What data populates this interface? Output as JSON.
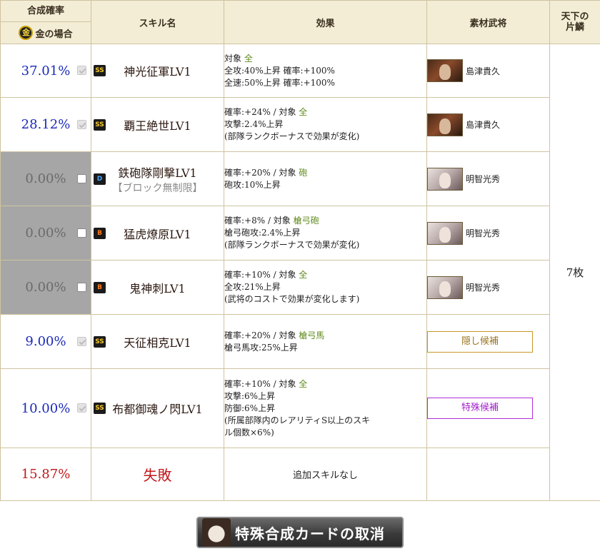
{
  "header": {
    "rate": "合成確率",
    "gold_case": "金の場合",
    "gold_icon_char": "金",
    "skill_name": "スキル名",
    "effect": "効果",
    "material": "素材武将",
    "tenka_line1": "天下の",
    "tenka_line2": "片鱗"
  },
  "rows": [
    {
      "rate": "37.01%",
      "checked": true,
      "rarity": "SS",
      "skill": "神光征軍LV1",
      "sub": "",
      "fx": [
        {
          "prefix": "対象",
          "target": "全",
          "text": ""
        },
        {
          "text": "全攻:40%上昇  確率:+100%"
        },
        {
          "text": "全速:50%上昇  確率:+100%"
        }
      ],
      "material": "島津貴久"
    },
    {
      "rate": "28.12%",
      "checked": true,
      "rarity": "SS",
      "skill": "覇王絶世LV1",
      "sub": "",
      "fx": [
        {
          "prefix": "確率:+24% / 対象",
          "target": "全",
          "text": ""
        },
        {
          "text": "攻撃:2.4%上昇"
        },
        {
          "text": "(部隊ランクボーナスで効果が変化)"
        }
      ],
      "material": "島津貴久"
    },
    {
      "rate": "0.00%",
      "checked": false,
      "rarity": "D",
      "skill": "鉄砲隊剛撃LV1",
      "sub": "【ブロック無制限】",
      "fx": [
        {
          "prefix": "確率:+20% / 対象",
          "target": "砲",
          "text": ""
        },
        {
          "text": "砲攻:10%上昇"
        }
      ],
      "material": "明智光秀"
    },
    {
      "rate": "0.00%",
      "checked": false,
      "rarity": "B",
      "skill": "猛虎燎原LV1",
      "sub": "",
      "fx": [
        {
          "prefix": "確率:+8% / 対象",
          "target": "槍弓砲",
          "text": ""
        },
        {
          "text": "槍弓砲攻:2.4%上昇"
        },
        {
          "text": "(部隊ランクボーナスで効果が変化)"
        }
      ],
      "material": "明智光秀"
    },
    {
      "rate": "0.00%",
      "checked": false,
      "rarity": "B",
      "skill": "鬼神刺LV1",
      "sub": "",
      "fx": [
        {
          "prefix": "確率:+10% / 対象",
          "target": "全",
          "text": ""
        },
        {
          "text": "全攻:21%上昇"
        },
        {
          "text": "(武将のコストで効果が変化します)"
        }
      ],
      "material": "明智光秀"
    },
    {
      "rate": "9.00%",
      "checked": true,
      "rarity": "SS",
      "skill": "天征相克LV1",
      "sub": "",
      "fx": [
        {
          "prefix": "確率:+20% / 対象",
          "target": "槍弓馬",
          "text": ""
        },
        {
          "text": "槍弓馬攻:25%上昇"
        }
      ],
      "candidate": "隠し候補"
    },
    {
      "rate": "10.00%",
      "checked": true,
      "rarity": "SS",
      "skill": "布都御魂ノ閃LV1",
      "sub": "",
      "fx": [
        {
          "prefix": "確率:+10% / 対象",
          "target": "全",
          "text": ""
        },
        {
          "text": "攻撃:6%上昇"
        },
        {
          "text": "防御:6%上昇"
        },
        {
          "text": "(所属部隊内のレアリティS以上のスキ"
        },
        {
          "text": "ル個数×6%)"
        }
      ],
      "candidate": "特殊候補"
    }
  ],
  "fail": {
    "rate": "15.87%",
    "label": "失敗",
    "effect": "追加スキルなし"
  },
  "shard_count": "7枚",
  "cancel_button": "特殊合成カードの取消",
  "colors": {
    "rate_blue": "#1a2ab8",
    "fail_red": "#c0171b",
    "target_green": "#5f8a1c",
    "header_bg": "#f3edd6"
  }
}
